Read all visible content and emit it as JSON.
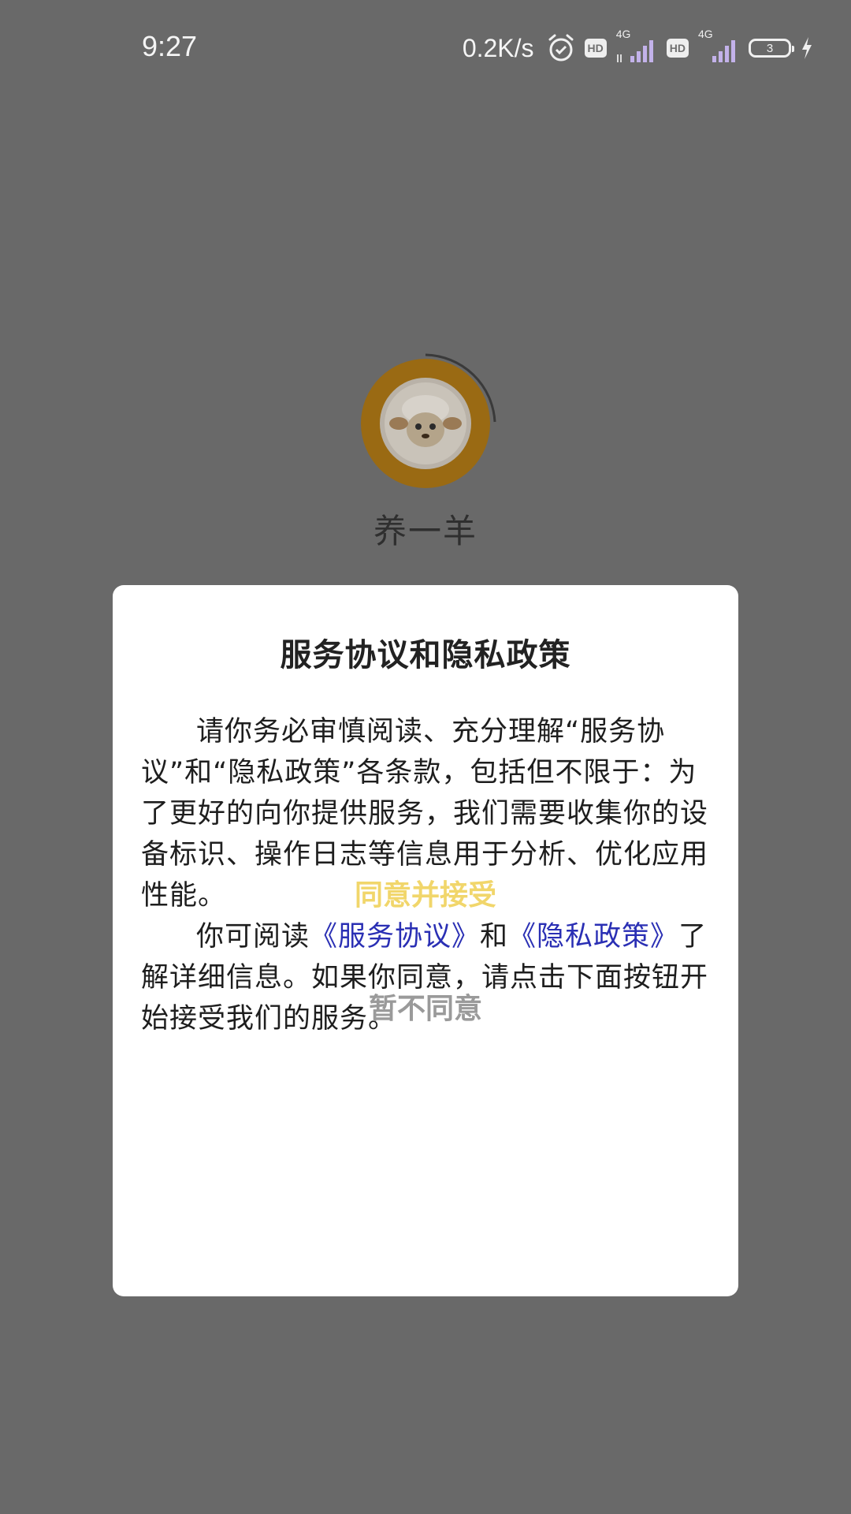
{
  "status_bar": {
    "time": "9:27",
    "net_speed": "0.2K/s",
    "hd_label": "HD",
    "network_label": "4G",
    "battery_level": "3"
  },
  "splash": {
    "app_name": "养一羊"
  },
  "dialog": {
    "title": "服务协议和隐私政策",
    "paragraph1": "请你务必审慎阅读、充分理解“服务协议”和“隐私政策”各条款，包括但不限于：为了更好的向你提供服务，我们需要收集你的设备标识、操作日志等信息用于分析、优化应用性能。",
    "paragraph2_prefix": "你可阅读",
    "service_link": "《服务协议》",
    "conjunction": "和",
    "privacy_link": "《隐私政策》",
    "paragraph2_suffix": "了解详细信息。如果你同意，请点击下面按钮开始接受我们的服务。",
    "agree_label": "同意并接受",
    "disagree_label": "暂不同意"
  },
  "colors": {
    "overlay": "#696969",
    "agree": "#f1d66b",
    "disagree": "#9a9a9a",
    "link": "#2a2fb4"
  }
}
